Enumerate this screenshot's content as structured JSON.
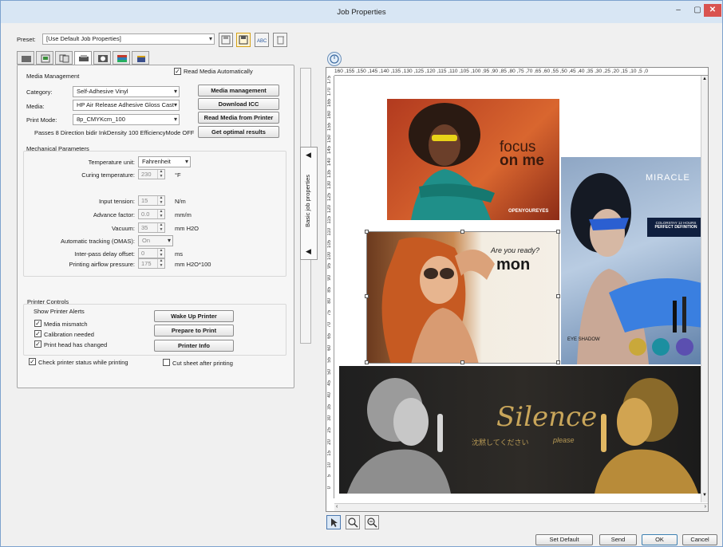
{
  "window": {
    "title": "Job Properties",
    "min_icon": "minimize-icon",
    "max_icon": "maximize-icon",
    "close_icon": "close-icon"
  },
  "preset": {
    "label": "Preset:",
    "value": "[Use Default Job Properties]"
  },
  "tabs": [
    "tab-general-icon",
    "tab-layout-icon",
    "tab-copies-icon",
    "tab-printer-icon",
    "tab-color-icon",
    "tab-finishing-icon",
    "tab-info-icon"
  ],
  "media_management": {
    "title": "Media Management",
    "read_auto_label": "Read Media Automatically",
    "read_auto_checked": true,
    "category_label": "Category:",
    "category_value": "Self-Adhesive Vinyl",
    "media_label": "Media:",
    "media_value": "HP Air Release Adhesive Gloss Cast",
    "print_mode_label": "Print Mode:",
    "print_mode_value": "8p_CMYKcm_100",
    "passes_text": "Passes 8 Direction bidir InkDensity 100 EfficiencyMode OFF",
    "btn_media_management": "Media management",
    "btn_download_icc": "Download ICC",
    "btn_read_media": "Read Media from Printer",
    "btn_optimal": "Get optimal results"
  },
  "mechanical": {
    "title": "Mechanical Parameters",
    "temp_unit_label": "Temperature unit:",
    "temp_unit_value": "Fahrenheit",
    "curing_label": "Curing temperature:",
    "curing_value": "230",
    "curing_unit": "°F",
    "input_tension_label": "Input tension:",
    "input_tension_value": "15",
    "input_tension_unit": "N/m",
    "advance_label": "Advance factor:",
    "advance_value": "0.0",
    "advance_unit": "mm/m",
    "vacuum_label": "Vacuum:",
    "vacuum_value": "35",
    "vacuum_unit": "mm H2O",
    "omas_label": "Automatic tracking (OMAS):",
    "omas_value": "On",
    "interpass_label": "Inter-pass delay offset:",
    "interpass_value": "0",
    "interpass_unit": "ms",
    "airflow_label": "Printing airflow pressure:",
    "airflow_value": "175",
    "airflow_unit": "mm H2O*100"
  },
  "printer_controls": {
    "title": "Printer Controls",
    "alerts_title": "Show Printer Alerts",
    "media_mismatch": "Media mismatch",
    "calibration": "Calibration needed",
    "printhead": "Print head has changed",
    "wake_up": "Wake Up Printer",
    "prepare": "Prepare to Print",
    "printer_info": "Printer Info",
    "check_status": "Check printer status while printing",
    "cut_sheet": "Cut sheet after printing"
  },
  "side_panel": {
    "label": "Basic job properties"
  },
  "ruler": {
    "top": "160 ,155 ,150 ,145 ,140 ,135 ,130 ,125 ,120 ,115 ,110 ,105 ,100 ,95  ,90  ,85  ,80  ,75  ,70  ,65  ,60  ,55  ,50  ,45  ,40  ,35  ,30  ,25  ,20  ,15  ,10  ,5   ,0",
    "left": [
      "175",
      "170",
      "165",
      "160",
      "155",
      "150",
      "145",
      "140",
      "135",
      "130",
      "125",
      "120",
      "115",
      "110",
      "105",
      "100",
      "95",
      "90",
      "85",
      "80",
      "75",
      "70",
      "65",
      "60",
      "55",
      "50",
      "45",
      "40",
      "35",
      "30",
      "25",
      "20",
      "15",
      "10",
      "5",
      "0"
    ]
  },
  "images": {
    "focus": {
      "line1": "focus",
      "line2": "on me",
      "brand": "OPENYOUREYES"
    },
    "miracle": {
      "brand": "MIRACLE",
      "promo1": "COLORSTAY 12 HOURS",
      "promo2": "PERFECT DEFINITION",
      "eyeshadow": "EYE SHADOW"
    },
    "ready": {
      "tagline": "Are you ready?",
      "logo": "mon"
    },
    "silence": {
      "title": "Silence",
      "jp": "沈黙してください",
      "please": "please"
    }
  },
  "bottom": {
    "set_default": "Set Default",
    "send": "Send",
    "ok": "OK",
    "cancel": "Cancel"
  },
  "colors": {
    "accent": "#d9534f",
    "titlebar": "#d8e6f4",
    "button": "#e8e8e8"
  }
}
